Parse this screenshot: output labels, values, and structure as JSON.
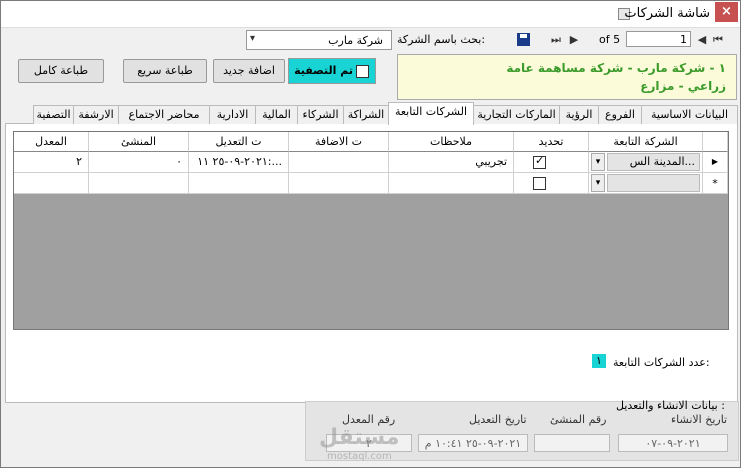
{
  "window": {
    "title": "شاشة الشركات",
    "close_glyph": "×"
  },
  "navigator": {
    "record": "1",
    "of_text": "of 5"
  },
  "search": {
    "label": "بحث باسم الشركة:",
    "selected": "شركة مارب"
  },
  "info": {
    "line1": "١ - شركة مارب - شركة مساهمة عامة",
    "line2": "زراعي - مزارع"
  },
  "toolbar": {
    "audit_label": "تم التصفية",
    "add_label": "اضافة جديد",
    "quick_print_label": "طباعة سريع",
    "full_print_label": "طباعة كامل"
  },
  "tabs": [
    {
      "label": "البيانات الاساسية"
    },
    {
      "label": "الفروع"
    },
    {
      "label": "الرؤية"
    },
    {
      "label": "الماركات التجارية"
    },
    {
      "label": "الشركات التابعة"
    },
    {
      "label": "الشراكة"
    },
    {
      "label": "الشركاء"
    },
    {
      "label": "المالية"
    },
    {
      "label": "الادارية"
    },
    {
      "label": "محاضر الاجتماع"
    },
    {
      "label": "الارشفة"
    },
    {
      "label": "التصفية"
    }
  ],
  "grid": {
    "headers": {
      "company": "الشركة التابعة",
      "renew": "تحديد",
      "notes": "ملاحظات",
      "added": "ت الاضافة",
      "modified": "ت التعديل",
      "creator": "المنشئ",
      "editor": "المعدل"
    },
    "row1": {
      "company": "المدينة الس...",
      "notes": "تجريبي",
      "added": "",
      "modified": "٢٠٢١-٠٩-٢٥ ١١:...",
      "creator": "٠",
      "editor": "٢",
      "checked": true
    },
    "new_row_marker": "*",
    "current_row_marker": "▶"
  },
  "count": {
    "label": "عدد الشركات التابعة:",
    "value": "١"
  },
  "meta": {
    "title": "بيانات الانشاء والتعديل :",
    "created_date_label": "تاريخ الانشاء",
    "creator_label": "رقم المنشئ",
    "modified_date_label": "تاريخ التعديل",
    "editor_label": "رقم المعدل",
    "created_date": "٢٠٢١-٠٩-٠٧",
    "creator": "",
    "modified_date": "٢٠٢١-٠٩-٢٥ ١٠:٤١ م",
    "editor": "٢"
  },
  "watermark": {
    "text": "مستقل",
    "sub": "mostaql.com"
  }
}
